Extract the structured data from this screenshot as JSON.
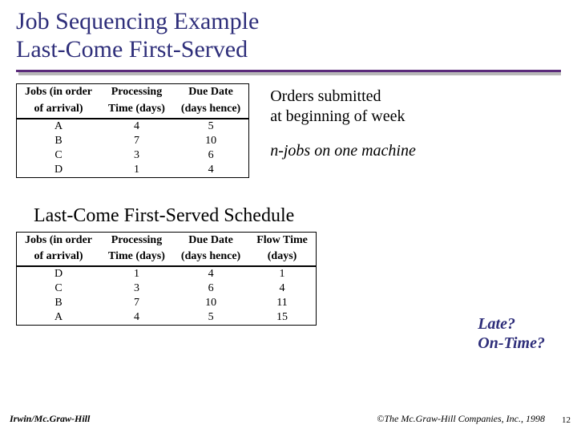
{
  "title": {
    "line1": "Job Sequencing Example",
    "line2": "Last-Come First-Served"
  },
  "table1": {
    "headers": {
      "c0a": "Jobs (in order",
      "c0b": "of arrival)",
      "c1a": "Processing",
      "c1b": "Time (days)",
      "c2a": "Due Date",
      "c2b": "(days hence)"
    },
    "rows": [
      {
        "job": "A",
        "proc": "4",
        "due": "5"
      },
      {
        "job": "B",
        "proc": "7",
        "due": "10"
      },
      {
        "job": "C",
        "proc": "3",
        "due": "6"
      },
      {
        "job": "D",
        "proc": "1",
        "due": "4"
      }
    ]
  },
  "notes": {
    "submitted_a": "Orders submitted",
    "submitted_b": "at beginning of week",
    "njobs": "n-jobs on one machine"
  },
  "subheading": "Last-Come First-Served Schedule",
  "table2": {
    "headers": {
      "c0a": "Jobs (in order",
      "c0b": "of arrival)",
      "c1a": "Processing",
      "c1b": "Time (days)",
      "c2a": "Due Date",
      "c2b": "(days hence)",
      "c3a": "Flow Time",
      "c3b": "(days)"
    },
    "rows": [
      {
        "job": "D",
        "proc": "1",
        "due": "4",
        "flow": "1"
      },
      {
        "job": "C",
        "proc": "3",
        "due": "6",
        "flow": "4"
      },
      {
        "job": "B",
        "proc": "7",
        "due": "10",
        "flow": "11"
      },
      {
        "job": "A",
        "proc": "4",
        "due": "5",
        "flow": "15"
      }
    ]
  },
  "callout": {
    "late": "Late?",
    "ontime": "On-Time?"
  },
  "footer": {
    "left": "Irwin/Mc.Graw-Hill",
    "right": "©The Mc.Graw-Hill Companies, Inc., 1998",
    "page": "12"
  },
  "chart_data": [
    {
      "type": "table",
      "title": "Jobs in order of arrival",
      "columns": [
        "Jobs (in order of arrival)",
        "Processing Time (days)",
        "Due Date (days hence)"
      ],
      "rows": [
        [
          "A",
          4,
          5
        ],
        [
          "B",
          7,
          10
        ],
        [
          "C",
          3,
          6
        ],
        [
          "D",
          1,
          4
        ]
      ]
    },
    {
      "type": "table",
      "title": "Last-Come First-Served Schedule",
      "columns": [
        "Jobs (in order of arrival)",
        "Processing Time (days)",
        "Due Date (days hence)",
        "Flow Time (days)"
      ],
      "rows": [
        [
          "D",
          1,
          4,
          1
        ],
        [
          "C",
          3,
          6,
          4
        ],
        [
          "B",
          7,
          10,
          11
        ],
        [
          "A",
          4,
          5,
          15
        ]
      ]
    }
  ]
}
